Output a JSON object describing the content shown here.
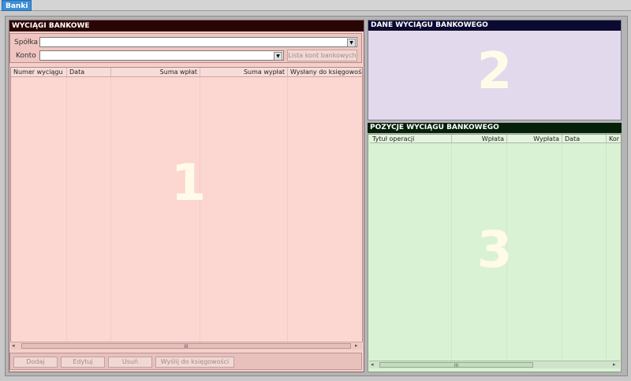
{
  "tab": {
    "label": "Banki"
  },
  "statements_panel": {
    "title": "WYCIĄGI BANKOWE",
    "company_label": "Spółka",
    "company_value": "",
    "account_label": "Konto",
    "account_value": "",
    "account_list_button": "Lista kont bankowych",
    "columns": [
      "Numer wyciągu",
      "Data",
      "Suma wpłat",
      "Suma wypłat",
      "Wysłany do księgowości"
    ],
    "rows": [],
    "placeholder_number": "1",
    "scroll_thumb": "III",
    "buttons": {
      "add": "Dodaj",
      "edit": "Edytuj",
      "delete": "Usuń",
      "send": "Wyślij do księgowości"
    }
  },
  "details_panel": {
    "title": "DANE WYCIĄGU BANKOWEGO",
    "placeholder_number": "2"
  },
  "items_panel": {
    "title": "POZYCJE WYCIĄGU BANKOWEGO",
    "columns": [
      "Tytuł operacji",
      "Wpłata",
      "Wypłata",
      "Data",
      "Kor"
    ],
    "rows": [],
    "placeholder_number": "3",
    "scroll_thumb": "III"
  },
  "colors": {
    "panel1_header": "#2a0505",
    "panel2_header": "#0b0a30",
    "panel3_header": "#052008",
    "panel1_bg": "#fcd6d1",
    "panel2_bg": "#e2d9ec",
    "panel3_bg": "#daf2d4",
    "tab_active": "#3c8fd8"
  }
}
